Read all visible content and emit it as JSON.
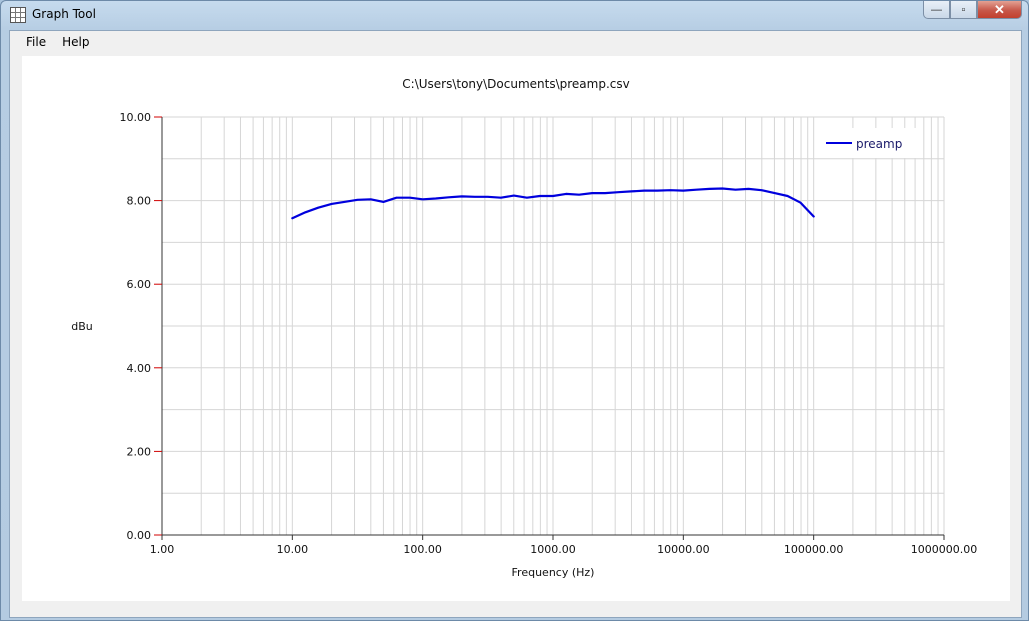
{
  "window": {
    "title": "Graph Tool"
  },
  "window_buttons": {
    "minimize": "—",
    "maximize": "▫",
    "close": "✕"
  },
  "menu": {
    "items": [
      {
        "label": "File"
      },
      {
        "label": "Help"
      }
    ]
  },
  "colors": {
    "series": "#0000dd",
    "grid": "#d6d6d6",
    "tick_mark": "#d00000"
  },
  "chart_data": {
    "type": "line",
    "title": "C:\\Users\\tony\\Documents\\preamp.csv",
    "xlabel": "Frequency (Hz)",
    "ylabel": "dBu",
    "xscale": "log",
    "xlim": [
      1,
      1000000
    ],
    "ylim": [
      0,
      10
    ],
    "grid": true,
    "legend_position": "top-right",
    "x_tick_labels": [
      "1.00",
      "10.00",
      "100.00",
      "1000.00",
      "10000.00",
      "100000.00",
      "1000000.00"
    ],
    "y_tick_labels": [
      "0.00",
      "2.00",
      "4.00",
      "6.00",
      "8.00",
      "10.00"
    ],
    "series": [
      {
        "name": "preamp",
        "x": [
          10,
          12.6,
          15.8,
          20,
          25,
          31.6,
          40,
          50,
          63,
          80,
          100,
          126,
          158,
          200,
          251,
          316,
          398,
          501,
          631,
          794,
          1000,
          1259,
          1585,
          1995,
          2512,
          3162,
          3981,
          5012,
          6310,
          7943,
          10000,
          12589,
          15849,
          19953,
          25119,
          31623,
          39811,
          50119,
          63096,
          79433,
          100000
        ],
        "y": [
          7.58,
          7.72,
          7.83,
          7.92,
          7.97,
          8.02,
          8.03,
          7.97,
          8.07,
          8.07,
          8.03,
          8.05,
          8.08,
          8.1,
          8.09,
          8.09,
          8.07,
          8.12,
          8.07,
          8.11,
          8.11,
          8.16,
          8.14,
          8.18,
          8.18,
          8.2,
          8.22,
          8.24,
          8.24,
          8.25,
          8.24,
          8.26,
          8.28,
          8.29,
          8.26,
          8.28,
          8.25,
          8.18,
          8.11,
          7.95,
          7.62
        ]
      }
    ]
  }
}
